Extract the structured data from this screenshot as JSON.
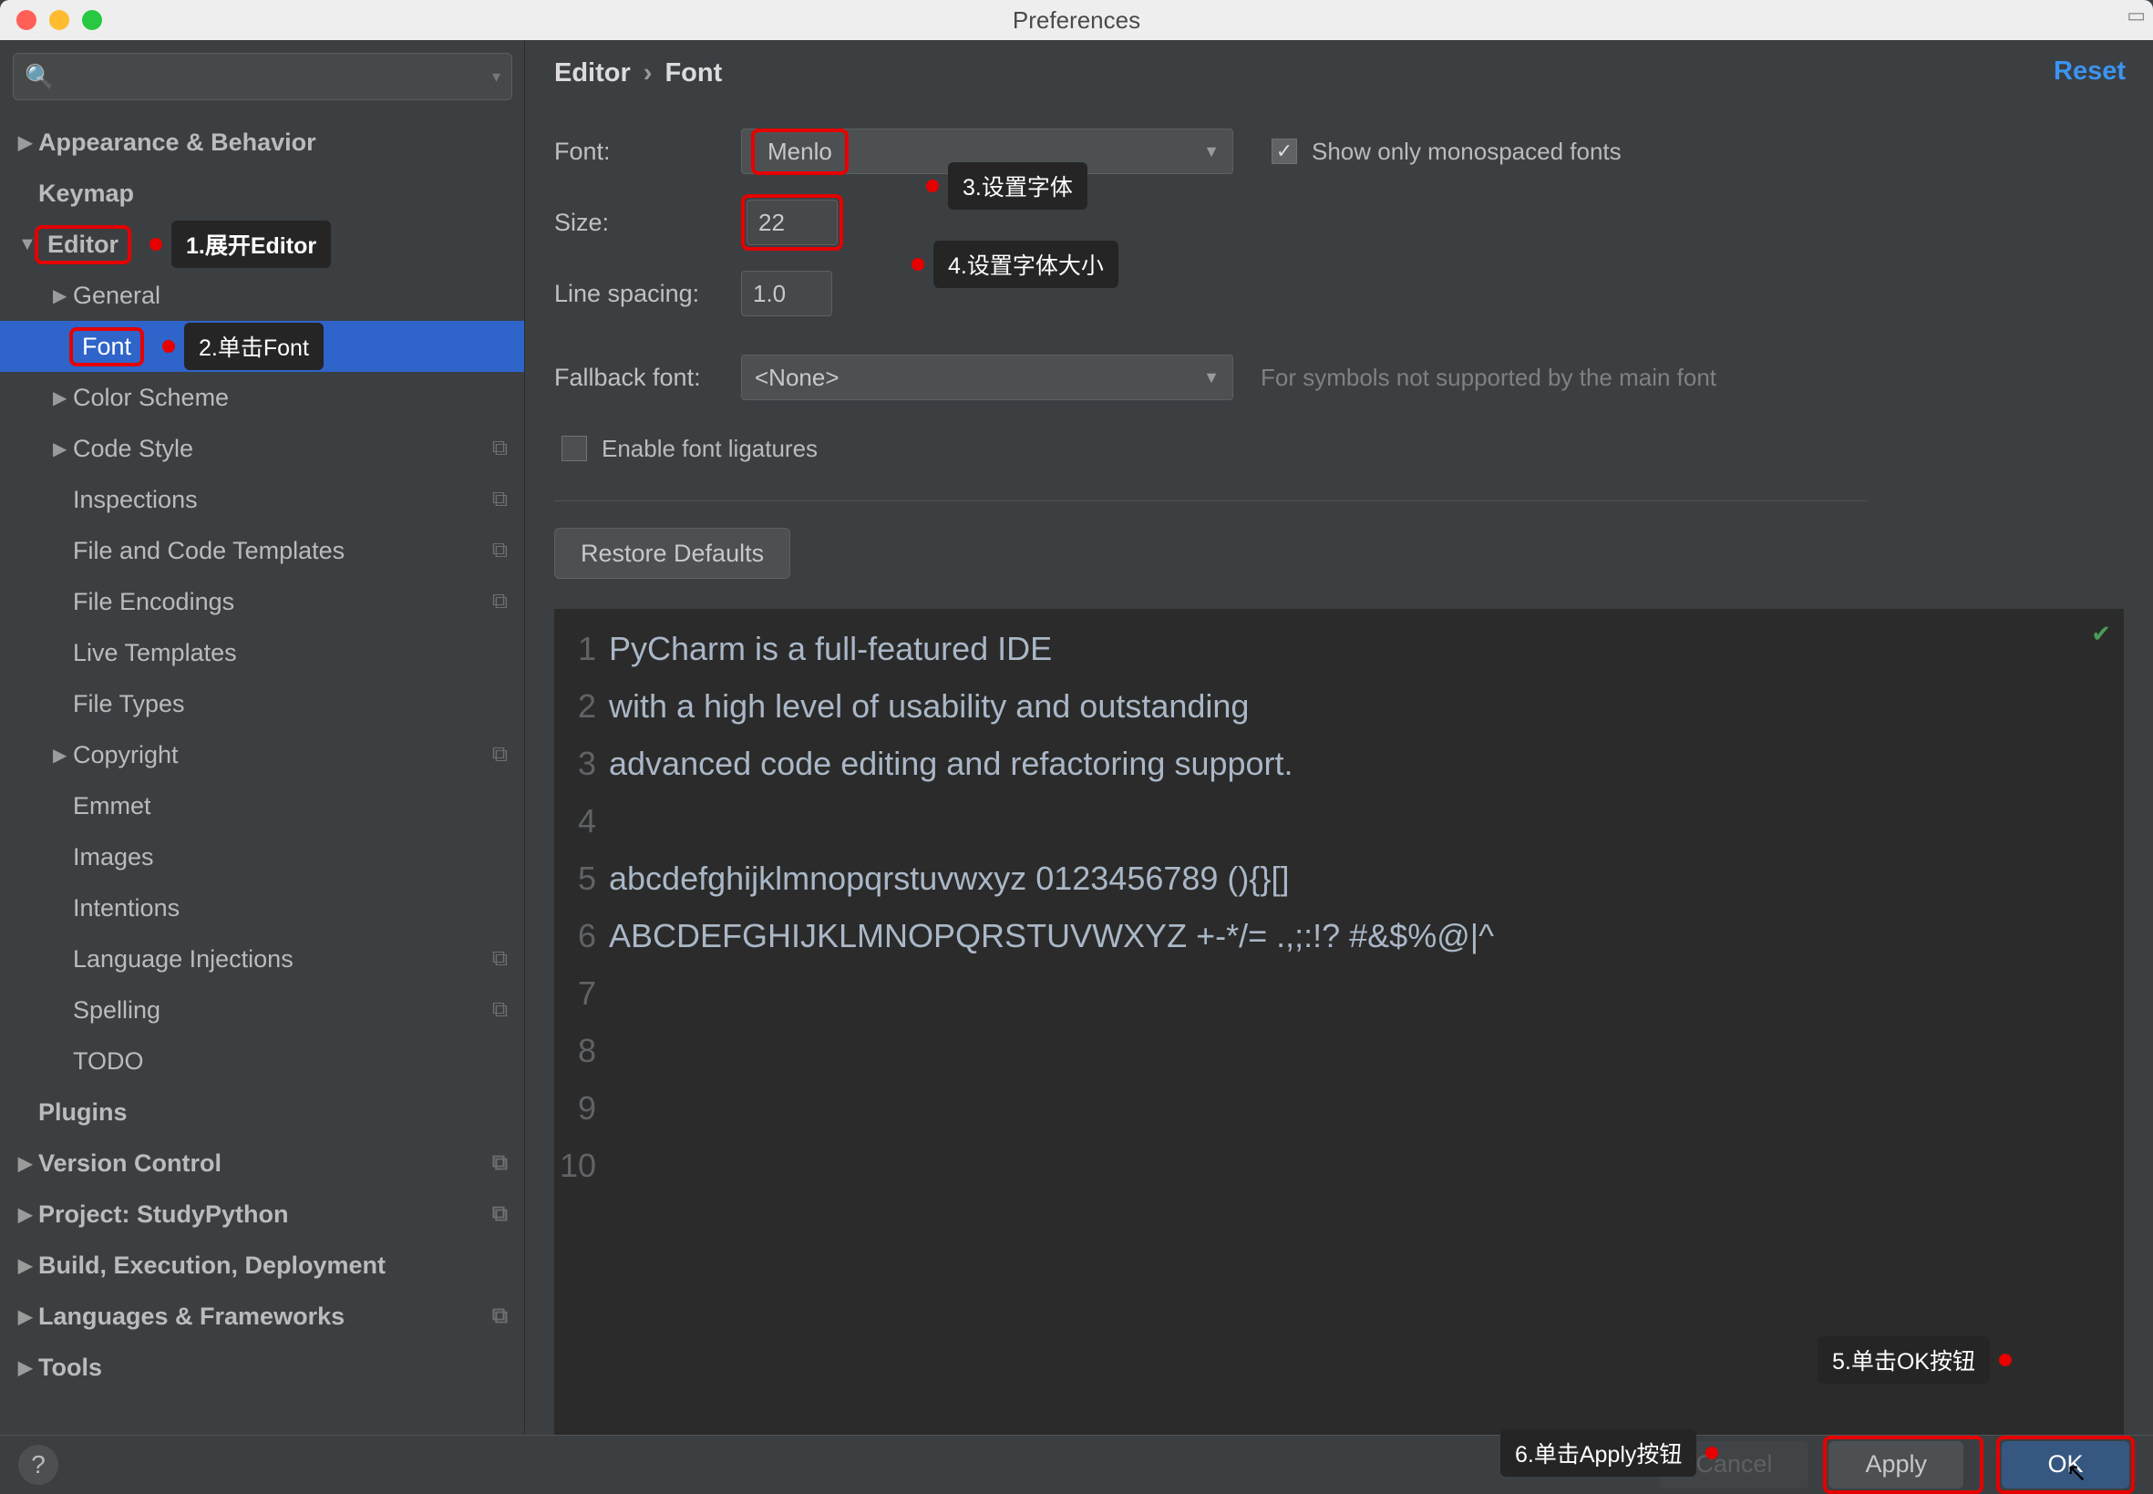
{
  "window": {
    "title": "Preferences"
  },
  "breadcrumb": {
    "root": "Editor",
    "leaf": "Font"
  },
  "reset_label": "Reset",
  "sidebar": {
    "search_placeholder": "",
    "items": [
      {
        "label": "Appearance & Behavior",
        "arrow": "right",
        "bold": true,
        "lvl": 0
      },
      {
        "label": "Keymap",
        "arrow": "",
        "bold": true,
        "lvl": 0
      },
      {
        "label": "Editor",
        "arrow": "down",
        "bold": true,
        "lvl": 0,
        "redbox": true,
        "callout": "1.展开Editor"
      },
      {
        "label": "General",
        "arrow": "right",
        "bold": false,
        "lvl": 1
      },
      {
        "label": "Font",
        "arrow": "",
        "bold": false,
        "lvl": 1,
        "selected": true,
        "redbox": true,
        "callout": "2.单击Font"
      },
      {
        "label": "Color Scheme",
        "arrow": "right",
        "bold": false,
        "lvl": 1
      },
      {
        "label": "Code Style",
        "arrow": "right",
        "bold": false,
        "lvl": 1,
        "dup": true
      },
      {
        "label": "Inspections",
        "arrow": "",
        "bold": false,
        "lvl": 1,
        "dup": true
      },
      {
        "label": "File and Code Templates",
        "arrow": "",
        "bold": false,
        "lvl": 1,
        "dup": true
      },
      {
        "label": "File Encodings",
        "arrow": "",
        "bold": false,
        "lvl": 1,
        "dup": true
      },
      {
        "label": "Live Templates",
        "arrow": "",
        "bold": false,
        "lvl": 1
      },
      {
        "label": "File Types",
        "arrow": "",
        "bold": false,
        "lvl": 1
      },
      {
        "label": "Copyright",
        "arrow": "right",
        "bold": false,
        "lvl": 1,
        "dup": true
      },
      {
        "label": "Emmet",
        "arrow": "",
        "bold": false,
        "lvl": 1
      },
      {
        "label": "Images",
        "arrow": "",
        "bold": false,
        "lvl": 1
      },
      {
        "label": "Intentions",
        "arrow": "",
        "bold": false,
        "lvl": 1
      },
      {
        "label": "Language Injections",
        "arrow": "",
        "bold": false,
        "lvl": 1,
        "dup": true
      },
      {
        "label": "Spelling",
        "arrow": "",
        "bold": false,
        "lvl": 1,
        "dup": true
      },
      {
        "label": "TODO",
        "arrow": "",
        "bold": false,
        "lvl": 1
      },
      {
        "label": "Plugins",
        "arrow": "",
        "bold": true,
        "lvl": 0
      },
      {
        "label": "Version Control",
        "arrow": "right",
        "bold": true,
        "lvl": 0,
        "dup": true
      },
      {
        "label": "Project: StudyPython",
        "arrow": "right",
        "bold": true,
        "lvl": 0,
        "dup": true
      },
      {
        "label": "Build, Execution, Deployment",
        "arrow": "right",
        "bold": true,
        "lvl": 0
      },
      {
        "label": "Languages & Frameworks",
        "arrow": "right",
        "bold": true,
        "lvl": 0,
        "dup": true
      },
      {
        "label": "Tools",
        "arrow": "right",
        "bold": true,
        "lvl": 0
      }
    ]
  },
  "form": {
    "font_label": "Font:",
    "font_value": "Menlo",
    "size_label": "Size:",
    "size_value": "22",
    "line_spacing_label": "Line spacing:",
    "line_spacing_value": "1.0",
    "fallback_label": "Fallback font:",
    "fallback_value": "<None>",
    "fallback_hint": "For symbols not supported by the main font",
    "mono_only_label": "Show only monospaced fonts",
    "ligatures_label": "Enable font ligatures",
    "restore_label": "Restore Defaults"
  },
  "preview": {
    "lines": [
      "PyCharm is a full-featured IDE",
      "with a high level of usability and outstanding",
      "advanced code editing and refactoring support.",
      "",
      "abcdefghijklmnopqrstuvwxyz 0123456789 (){}[]",
      "ABCDEFGHIJKLMNOPQRSTUVWXYZ +-*/= .,;:!? #&$%@|^",
      "",
      "",
      "",
      ""
    ]
  },
  "footer": {
    "cancel": "Cancel",
    "apply": "Apply",
    "ok": "OK"
  },
  "callouts": {
    "c3": "3.设置字体",
    "c4": "4.设置字体大小",
    "c5": "5.单击OK按钮",
    "c6": "6.单击Apply按钮"
  }
}
